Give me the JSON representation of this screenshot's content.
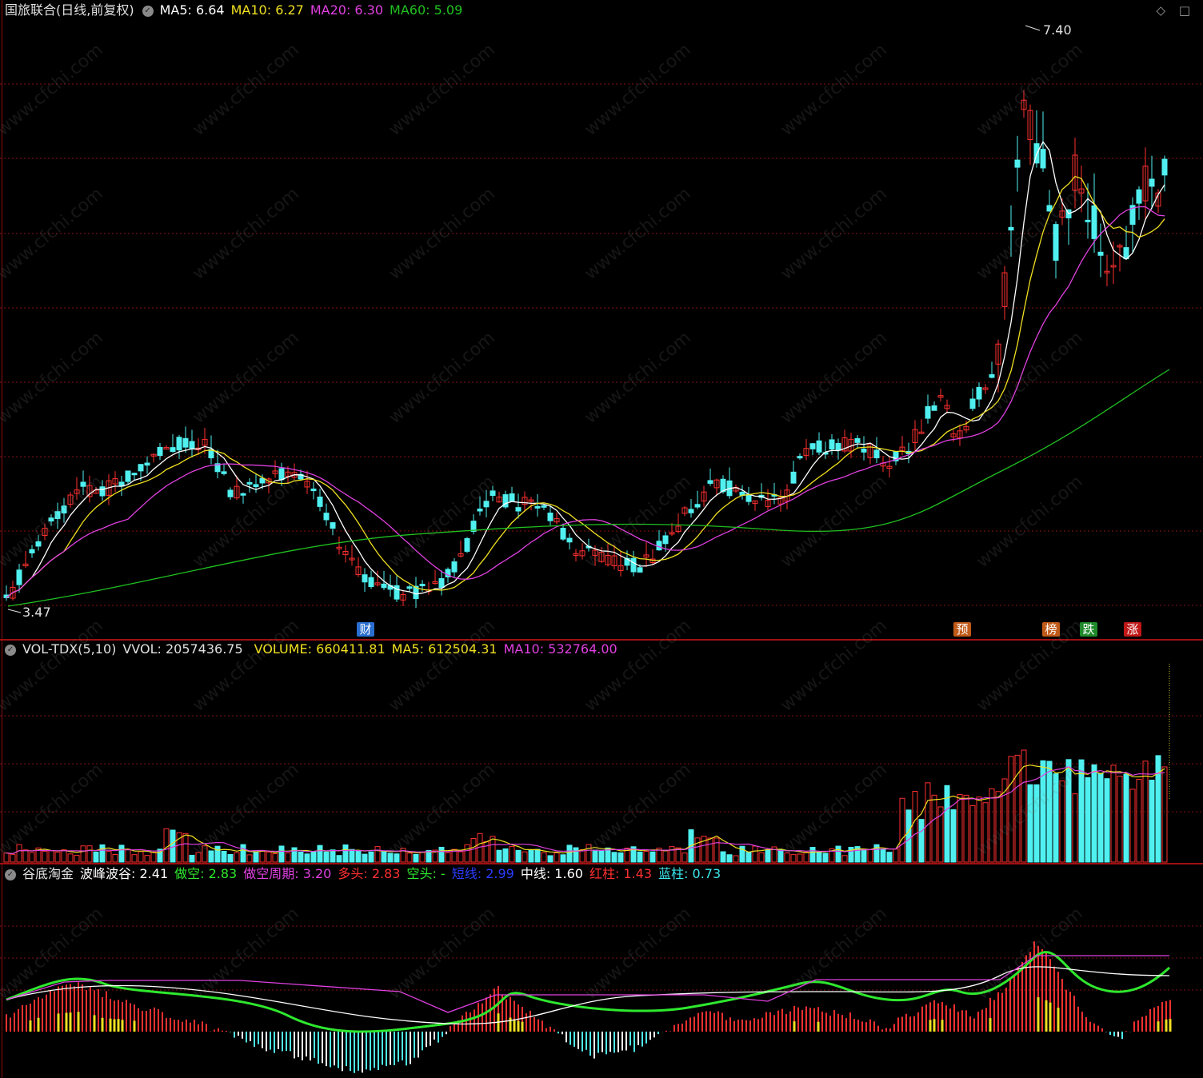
{
  "main": {
    "title": "国旅联合(日线,前复权)",
    "ma5": "MA5: 6.64",
    "ma10": "MA10: 6.27",
    "ma20": "MA20: 6.30",
    "ma60": "MA60: 5.09",
    "high_label": "7.40",
    "low_label": "3.47",
    "badges": [
      {
        "text": "财",
        "color": "#2a6fd0"
      },
      {
        "text": "预",
        "color": "#c05a18"
      },
      {
        "text": "榜",
        "color": "#c05a18"
      },
      {
        "text": "跌",
        "color": "#1e8a2a"
      },
      {
        "text": "涨",
        "color": "#c01818"
      }
    ],
    "top_icons": "◇ □"
  },
  "volume": {
    "name": "VOL-TDX(5,10)",
    "vvol": "VVOL: 2057436.75",
    "volume": "VOLUME: 660411.81",
    "ma5": "MA5: 612504.31",
    "ma10": "MA10: 532764.00"
  },
  "indicator": {
    "name": "谷底淘金",
    "items": [
      {
        "label": "波峰波谷: 2.41",
        "color": "#ffffff"
      },
      {
        "label": "做空: 2.83",
        "color": "#2ee82e"
      },
      {
        "label": "做空周期: 3.20",
        "color": "#e040e0"
      },
      {
        "label": "多头: 2.83",
        "color": "#ff3030"
      },
      {
        "label": "空头: -",
        "color": "#2ee82e"
      },
      {
        "label": "短线: 2.99",
        "color": "#2a3cff"
      },
      {
        "label": "中线: 1.60",
        "color": "#ffffff"
      },
      {
        "label": "红柱: 1.43",
        "color": "#ff3030"
      },
      {
        "label": "蓝柱: 0.73",
        "color": "#3ce8ee"
      }
    ]
  },
  "watermark": "www.cfchi.com",
  "colors": {
    "up": "#ff3030",
    "down": "#50f0f0",
    "ma5": "#ffffff",
    "ma10": "#f0e020",
    "ma20": "#e040e0",
    "ma60": "#20c020",
    "grid": "#8a1010"
  }
}
